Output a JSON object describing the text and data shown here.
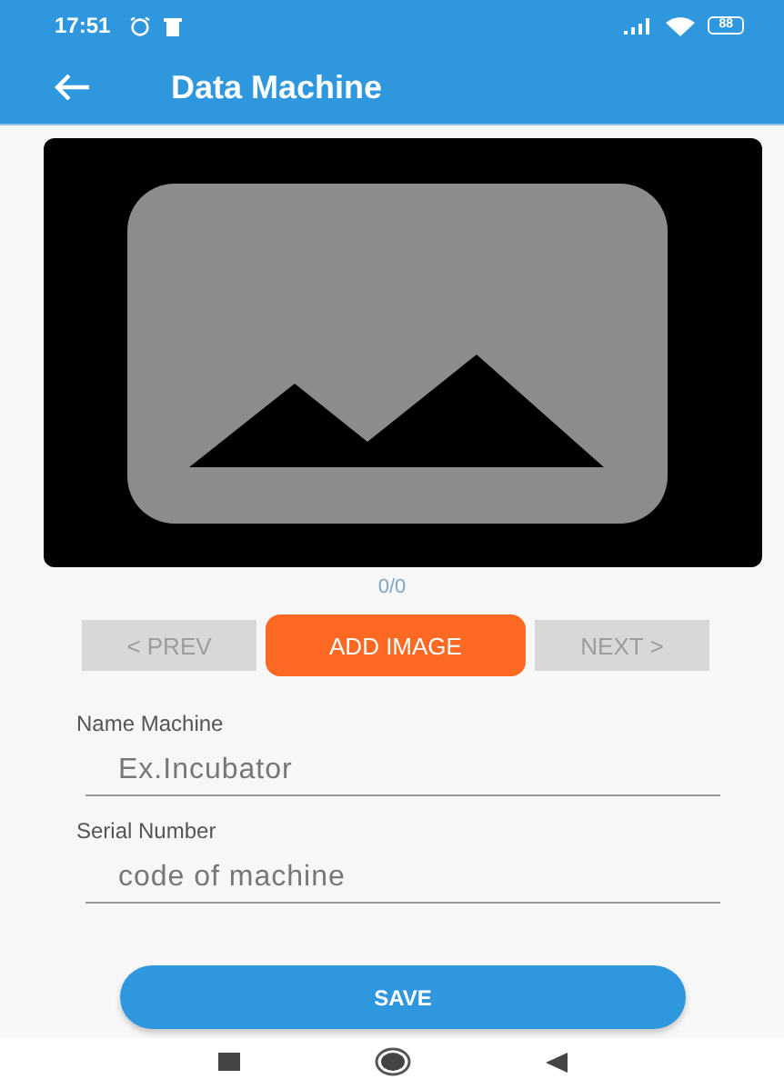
{
  "status_bar": {
    "time": "17:51",
    "battery": "88"
  },
  "app_bar": {
    "title": "Data Machine"
  },
  "gallery": {
    "counter": "0/0"
  },
  "nav_buttons": [
    {
      "kind": "nav",
      "label": "<  PREV",
      "disabled": true
    },
    {
      "kind": "primary",
      "label": "ADD IMAGE",
      "disabled": false
    },
    {
      "kind": "nav",
      "label": "NEXT  >",
      "disabled": true
    }
  ],
  "fields": [
    {
      "label": "Name Machine",
      "placeholder": "Ex.Incubator"
    },
    {
      "label": "Serial Number",
      "placeholder": "code of machine"
    }
  ],
  "save_button": {
    "label": "SAVE"
  }
}
